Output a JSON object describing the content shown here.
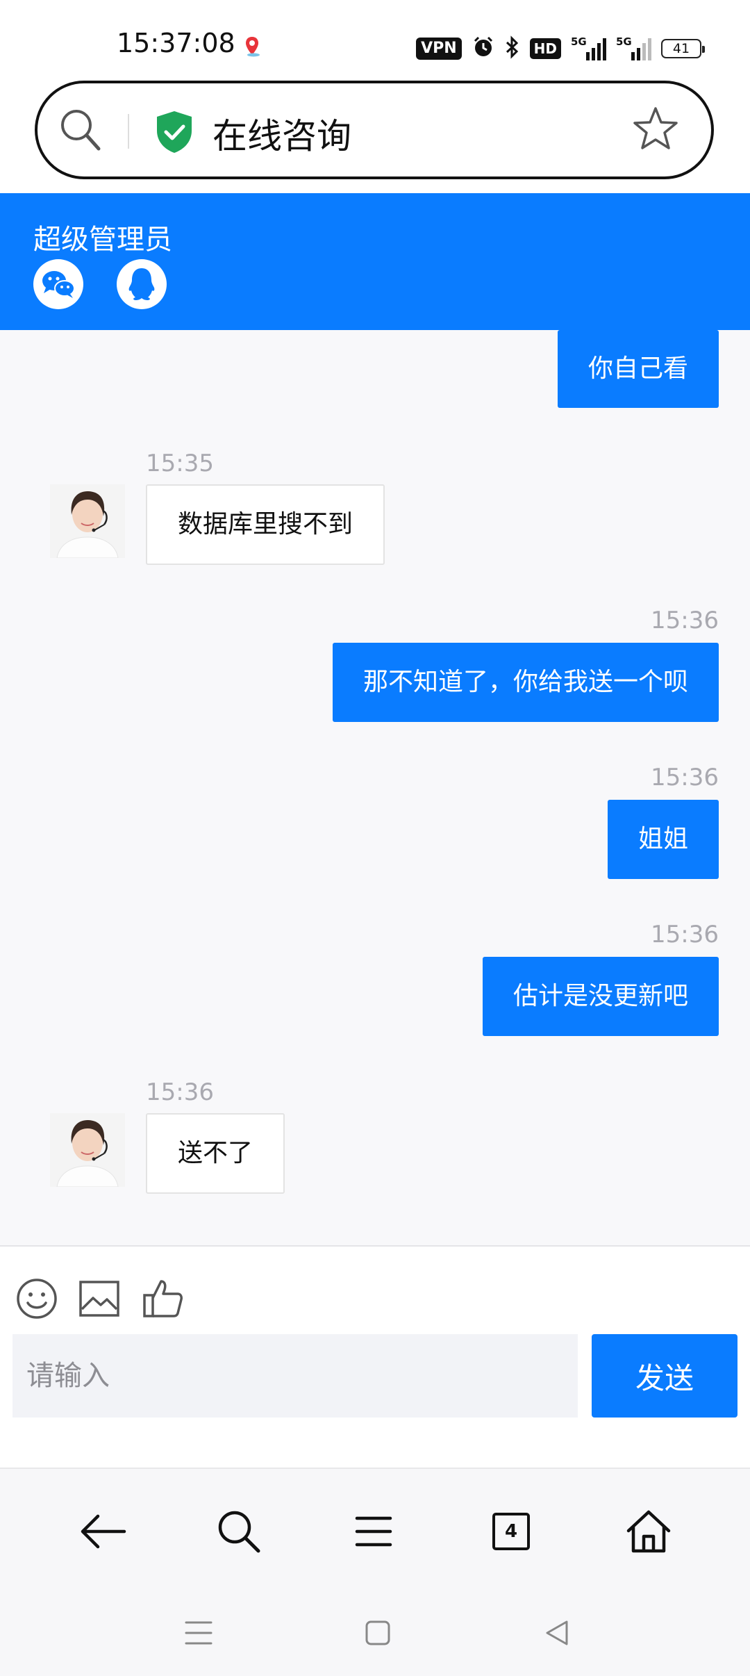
{
  "status_bar": {
    "time": "15:37:08",
    "vpn": "VPN",
    "hd": "HD",
    "sim1_label": "5G",
    "sim2_label": "5G",
    "battery": "41"
  },
  "address_bar": {
    "title": "在线咨询"
  },
  "header": {
    "agent_name": "超级管理员",
    "background_color": "#0a7cff"
  },
  "messages": [
    {
      "from": "me",
      "time": "",
      "text": "你自己看"
    },
    {
      "from": "agent",
      "time": "15:35",
      "text": "数据库里搜不到"
    },
    {
      "from": "me",
      "time": "15:36",
      "text": "那不知道了，你给我送一个呗"
    },
    {
      "from": "me",
      "time": "15:36",
      "text": "姐姐"
    },
    {
      "from": "me",
      "time": "15:36",
      "text": "估计是没更新吧"
    },
    {
      "from": "agent",
      "time": "15:36",
      "text": "送不了"
    }
  ],
  "input": {
    "placeholder": "请输入",
    "value": "",
    "send_label": "发送"
  },
  "browser_nav": {
    "tab_count": "4"
  }
}
